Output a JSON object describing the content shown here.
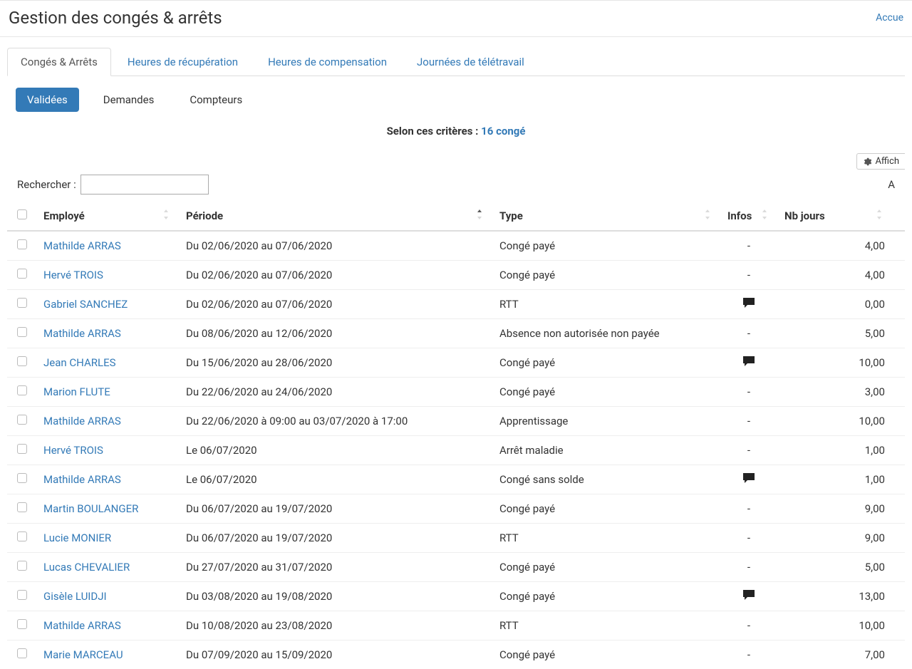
{
  "header": {
    "title": "Gestion des congés & arrêts",
    "breadcrumb_link": "Accue"
  },
  "main_tabs": [
    {
      "label": "Congés & Arrêts",
      "active": true
    },
    {
      "label": "Heures de récupération",
      "active": false
    },
    {
      "label": "Heures de compensation",
      "active": false
    },
    {
      "label": "Journées de télétravail",
      "active": false
    }
  ],
  "sub_tabs": [
    {
      "label": "Validées",
      "active": true
    },
    {
      "label": "Demandes",
      "active": false
    },
    {
      "label": "Compteurs",
      "active": false
    }
  ],
  "criteria": {
    "label": "Selon ces critères : ",
    "link_text": "16 congé"
  },
  "toolbar": {
    "afficher_label": "Affich"
  },
  "search": {
    "label": "Rechercher :",
    "value": "",
    "right_fragment": "A"
  },
  "columns": {
    "employe": "Employé",
    "periode": "Période",
    "type": "Type",
    "infos": "Infos",
    "nb_jours": "Nb jours"
  },
  "rows": [
    {
      "employee": "Mathilde ARRAS",
      "period": "Du 02/06/2020 au 07/06/2020",
      "type": "Congé payé",
      "has_comment": false,
      "days": "4,00"
    },
    {
      "employee": "Hervé TROIS",
      "period": "Du 02/06/2020 au 07/06/2020",
      "type": "Congé payé",
      "has_comment": false,
      "days": "4,00"
    },
    {
      "employee": "Gabriel SANCHEZ",
      "period": "Du 02/06/2020 au 07/06/2020",
      "type": "RTT",
      "has_comment": true,
      "days": "0,00"
    },
    {
      "employee": "Mathilde ARRAS",
      "period": "Du 08/06/2020 au 12/06/2020",
      "type": "Absence non autorisée non payée",
      "has_comment": false,
      "days": "5,00"
    },
    {
      "employee": "Jean CHARLES",
      "period": "Du 15/06/2020 au 28/06/2020",
      "type": "Congé payé",
      "has_comment": true,
      "days": "10,00"
    },
    {
      "employee": "Marion FLUTE",
      "period": "Du 22/06/2020 au 24/06/2020",
      "type": "Congé payé",
      "has_comment": false,
      "days": "3,00"
    },
    {
      "employee": "Mathilde ARRAS",
      "period": "Du 22/06/2020 à 09:00 au 03/07/2020 à 17:00",
      "type": "Apprentissage",
      "has_comment": false,
      "days": "10,00"
    },
    {
      "employee": "Hervé TROIS",
      "period": "Le 06/07/2020",
      "type": "Arrêt maladie",
      "has_comment": false,
      "days": "1,00"
    },
    {
      "employee": "Mathilde ARRAS",
      "period": "Le 06/07/2020",
      "type": "Congé sans solde",
      "has_comment": true,
      "days": "1,00"
    },
    {
      "employee": "Martin BOULANGER",
      "period": "Du 06/07/2020 au 19/07/2020",
      "type": "Congé payé",
      "has_comment": false,
      "days": "9,00"
    },
    {
      "employee": "Lucie MONIER",
      "period": "Du 06/07/2020 au 19/07/2020",
      "type": "RTT",
      "has_comment": false,
      "days": "9,00"
    },
    {
      "employee": "Lucas CHEVALIER",
      "period": "Du 27/07/2020 au 31/07/2020",
      "type": "Congé payé",
      "has_comment": false,
      "days": "5,00"
    },
    {
      "employee": "Gisèle LUIDJI",
      "period": "Du 03/08/2020 au 19/08/2020",
      "type": "Congé payé",
      "has_comment": true,
      "days": "13,00"
    },
    {
      "employee": "Mathilde ARRAS",
      "period": "Du 10/08/2020 au 23/08/2020",
      "type": "RTT",
      "has_comment": false,
      "days": "10,00"
    },
    {
      "employee": "Marie MARCEAU",
      "period": "Du 07/09/2020 au 15/09/2020",
      "type": "Congé payé",
      "has_comment": false,
      "days": "7,00"
    }
  ]
}
